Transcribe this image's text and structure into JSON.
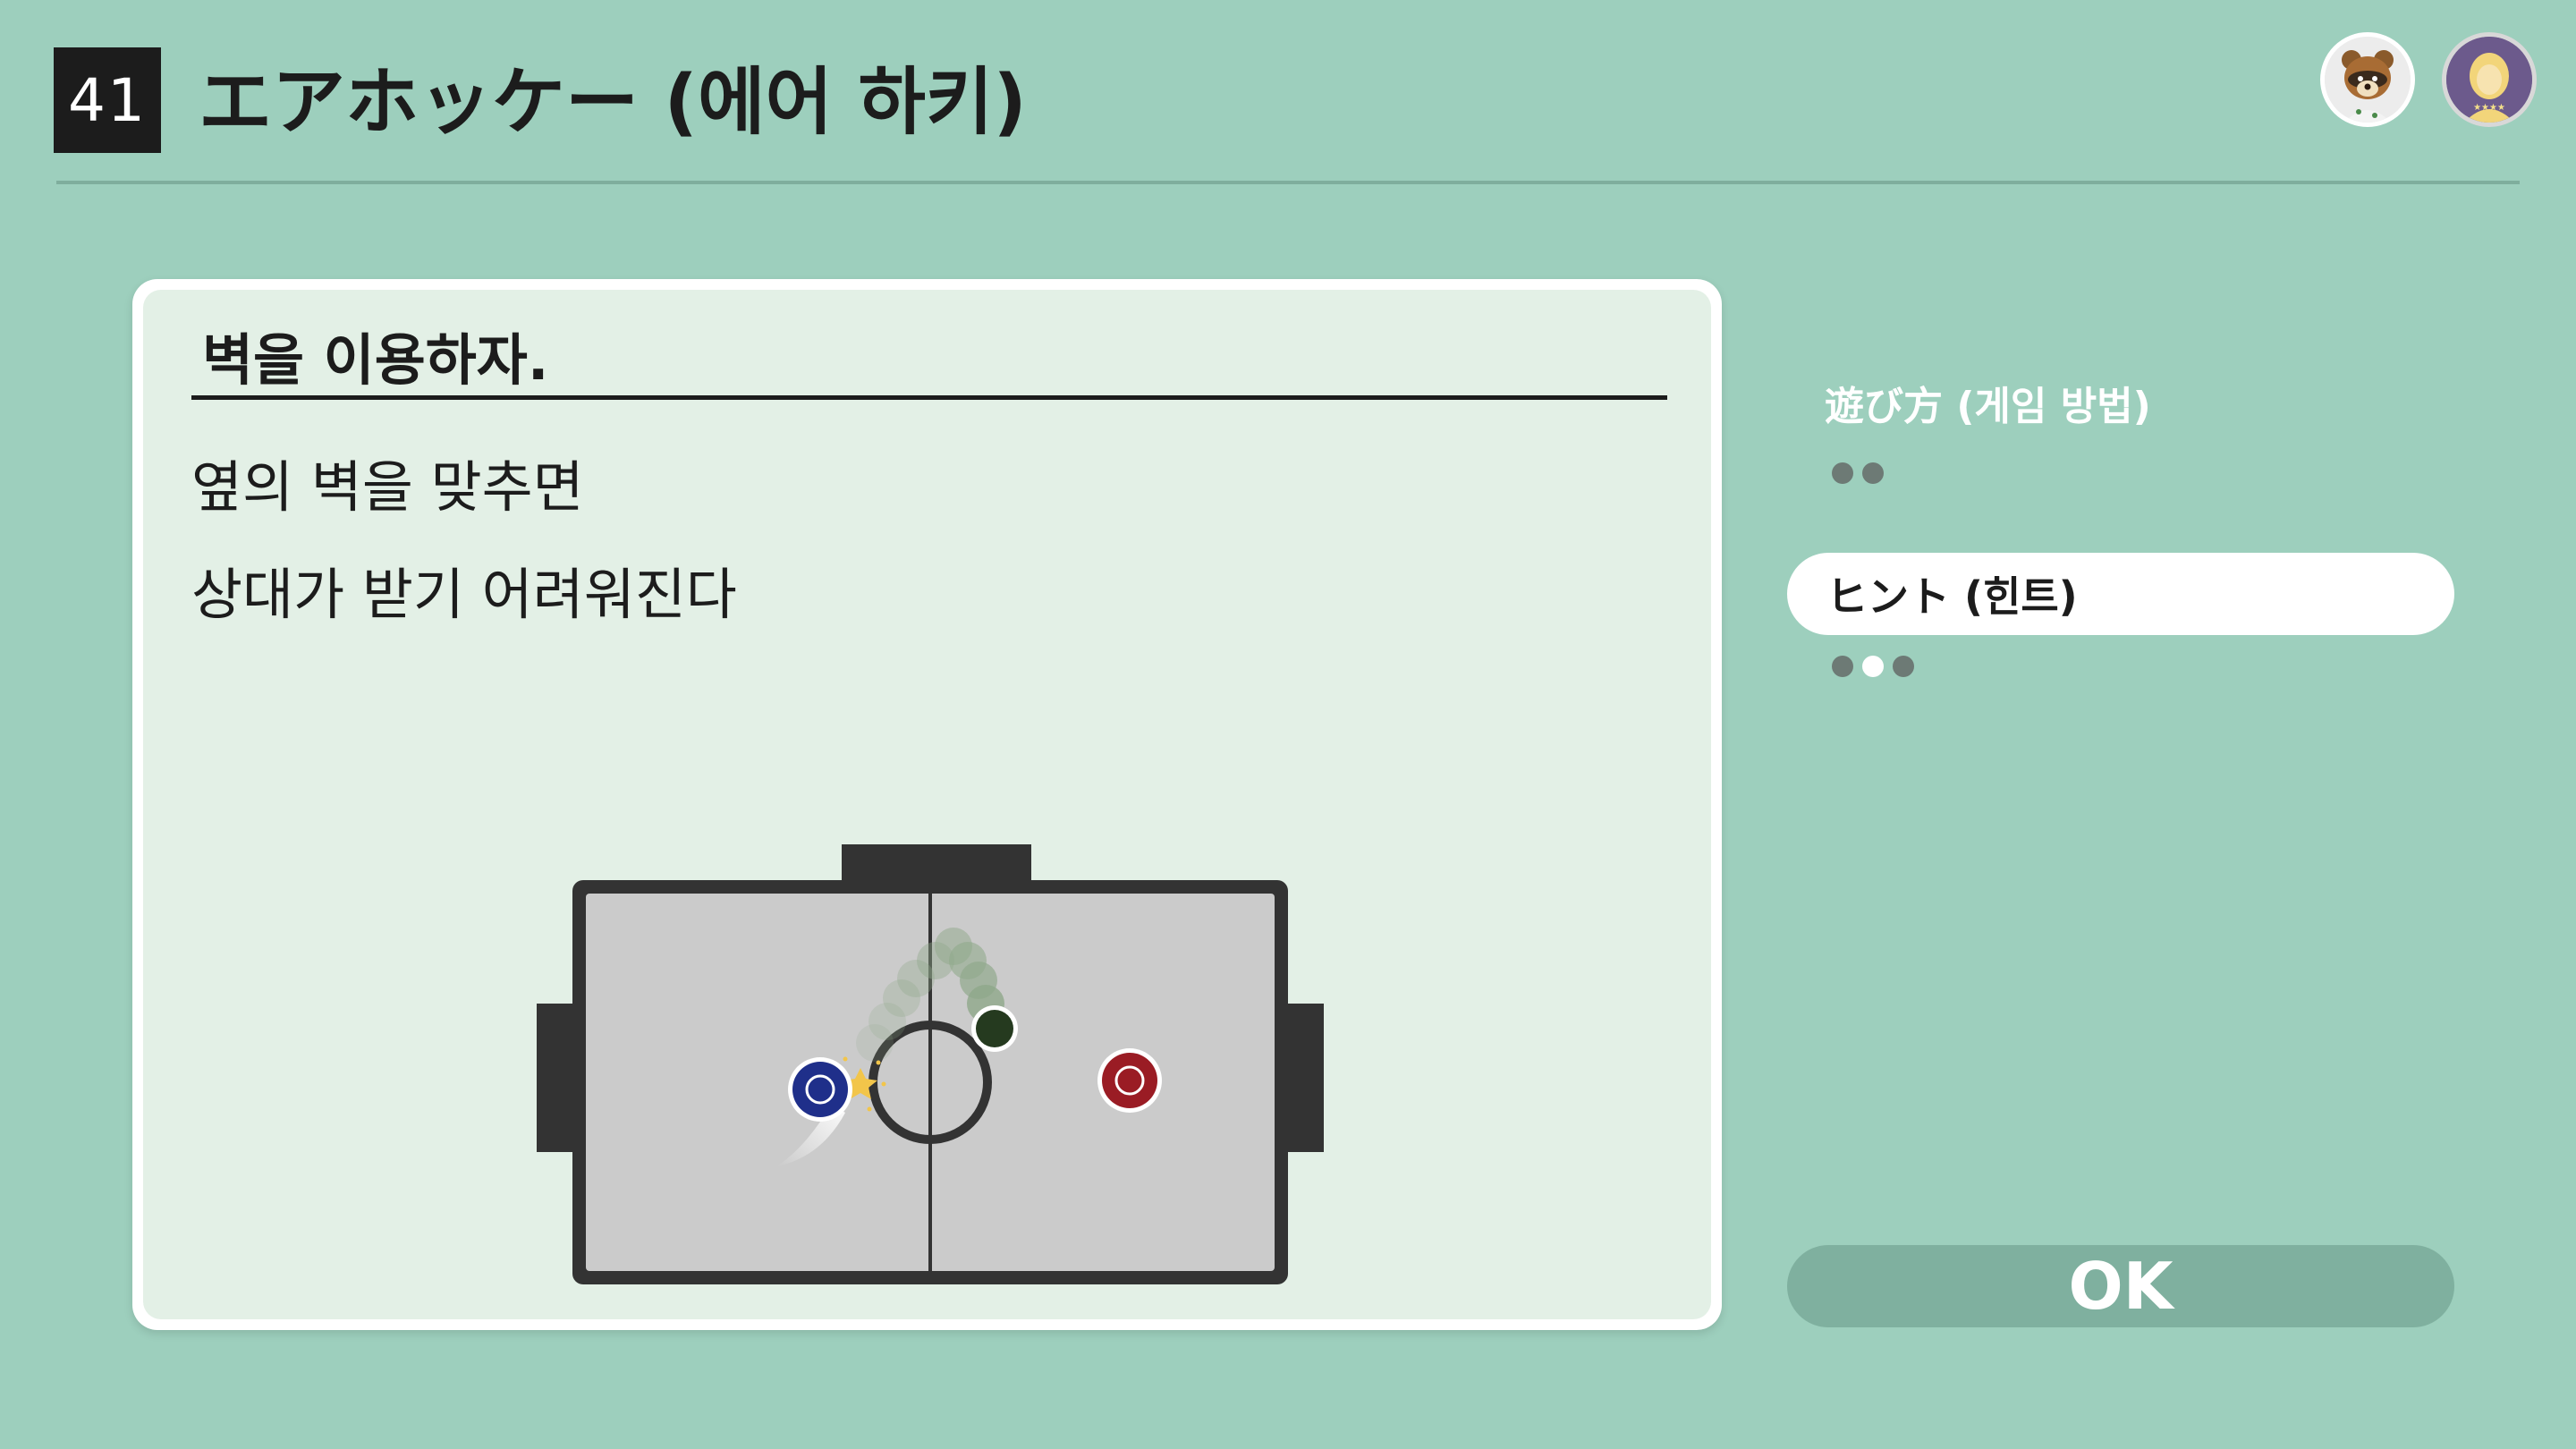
{
  "header": {
    "number": "41",
    "title": "エアホッケー (에어 하키)"
  },
  "hint_card": {
    "title": "벽을 이용하자.",
    "lines": [
      "옆의 벽을 맞추면",
      "상대가 받기 어려워진다"
    ]
  },
  "menu": {
    "how_to_play_label": "遊び方 (게임 방법)",
    "how_to_play_pages": {
      "total": 2,
      "current": 0
    },
    "hint_label": "ヒント (힌트)",
    "hint_pages": {
      "total": 3,
      "current": 1
    },
    "ok_label": "OK"
  },
  "colors": {
    "background": "#9dcfbd",
    "card": "#e3f0e6",
    "ok_button": "#7fb09f",
    "player_mallet": "#1f2f8a",
    "opponent_mallet": "#9a1c24",
    "puck": "#253a1f"
  },
  "icons": {
    "avatar_1": "raccoon-character-icon",
    "avatar_2": "blonde-character-icon"
  }
}
